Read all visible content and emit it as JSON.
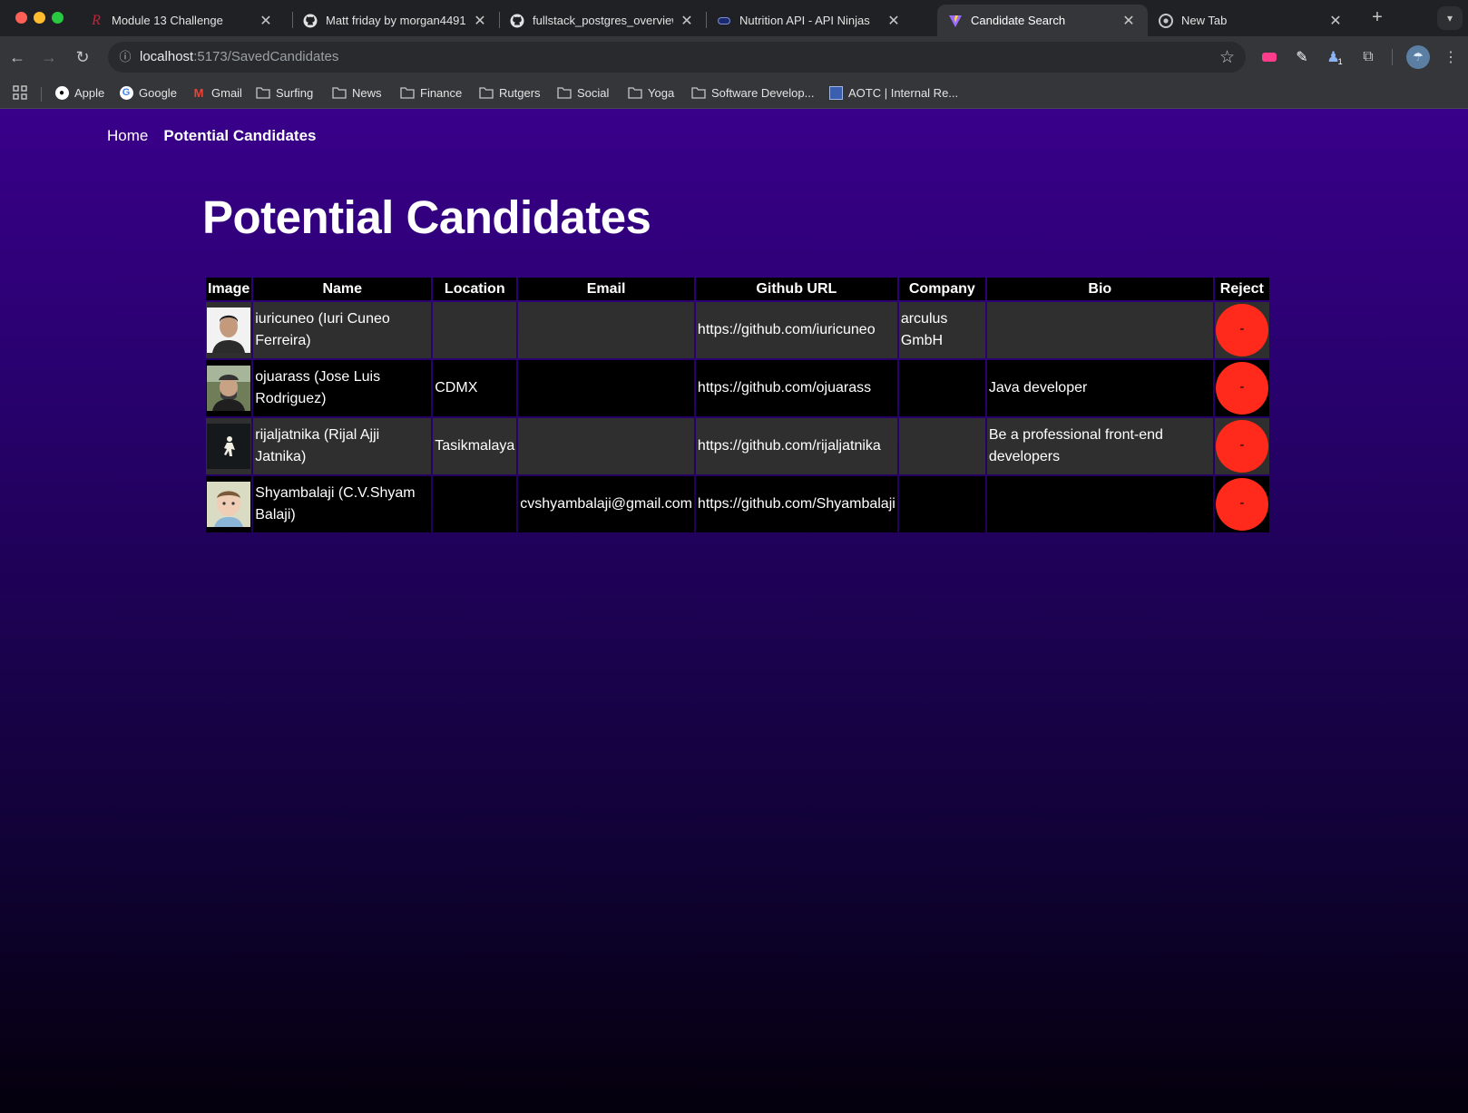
{
  "browser": {
    "tabs": [
      {
        "title": "Module 13 Challenge",
        "icon": "r-logo-icon"
      },
      {
        "title": "Matt friday by morgan4491 · ",
        "icon": "github-icon"
      },
      {
        "title": "fullstack_postgres_overview",
        "icon": "github-icon"
      },
      {
        "title": "Nutrition API - API Ninjas",
        "icon": "api-ninjas-icon"
      },
      {
        "title": "Candidate Search",
        "icon": "vite-icon"
      },
      {
        "title": "New Tab",
        "icon": "chrome-icon"
      }
    ],
    "active_tab": 4,
    "url_host": "localhost",
    "url_path": ":5173/SavedCandidates",
    "bookmarks": [
      "Apple",
      "Google",
      "Gmail",
      "Surfing",
      "News",
      "Finance",
      "Rutgers",
      "Social",
      "Yoga",
      "Software Develop...",
      "AOTC | Internal Re..."
    ],
    "extension_badge": "1"
  },
  "page": {
    "nav": {
      "home": "Home",
      "current": "Potential Candidates"
    },
    "title": "Potential Candidates",
    "table": {
      "headers": [
        "Image",
        "Name",
        "Location",
        "Email",
        "Github URL",
        "Company",
        "Bio",
        "Reject"
      ],
      "rows": [
        {
          "name": "iuricuneo (Iuri Cuneo Ferreira)",
          "location": "",
          "email": "",
          "github": "https://github.com/iuricuneo",
          "company": "arculus GmbH",
          "bio": "",
          "reject": "-"
        },
        {
          "name": "ojuarass (Jose Luis Rodriguez)",
          "location": "CDMX",
          "email": "",
          "github": "https://github.com/ojuarass",
          "company": "",
          "bio": "Java developer",
          "reject": "-"
        },
        {
          "name": "rijaljatnika (Rijal Ajji Jatnika)",
          "location": "Tasikmalaya",
          "email": "",
          "github": "https://github.com/rijaljatnika",
          "company": "",
          "bio": "Be a professional front-end developers",
          "reject": "-"
        },
        {
          "name": "Shyambalaji (C.V.Shyam Balaji)",
          "location": "",
          "email": "cvshyambalaji@gmail.com",
          "github": "https://github.com/Shyambalaji",
          "company": "",
          "bio": "",
          "reject": "-"
        }
      ]
    }
  },
  "colors": {
    "accent_link": "#6f45ff",
    "reject_button": "#ff2a1b",
    "gradient_top": "#39008a",
    "gradient_bottom": "#04000c"
  }
}
